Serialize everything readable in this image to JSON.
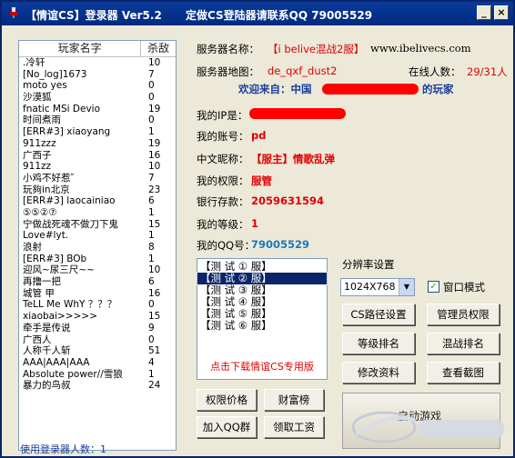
{
  "window": {
    "title": "【情谊CS】登录器 Ver5.2",
    "subtitle": "定做CS登陆器请联系QQ 79005529",
    "min_label": "_",
    "close_label": "×"
  },
  "player_list": {
    "headers": [
      "玩家名字",
      "杀敌"
    ],
    "rows": [
      [
        ".冷轩",
        "10"
      ],
      [
        "[No_log]1673",
        "7"
      ],
      [
        "moto yes",
        "0"
      ],
      [
        "沙漠狐",
        "0"
      ],
      [
        "fnatic MSi Devio",
        "19"
      ],
      [
        "时间煮雨",
        "0"
      ],
      [
        "[ERR#3] xiaoyang",
        "1"
      ],
      [
        "911zzz",
        "19"
      ],
      [
        "广西子",
        "16"
      ],
      [
        "911zz",
        "10"
      ],
      [
        "小鸡不好惹″",
        "7"
      ],
      [
        "玩夠in北京",
        "23"
      ],
      [
        "[ERR#3] laocainiao",
        "6"
      ],
      [
        "⑤⑤②⑦",
        "1"
      ],
      [
        "宁做战死魂不做刀下鬼",
        "15"
      ],
      [
        "Love#lyt.",
        "1"
      ],
      [
        "浪射",
        "8"
      ],
      [
        "[ERR#3] BOb",
        "1"
      ],
      [
        "迎风~尿三尺~~",
        "10"
      ],
      [
        "再撸一把",
        "6"
      ],
      [
        "城管 甲",
        "16"
      ],
      [
        "TeLL Me WhY ？？？",
        "0"
      ],
      [
        "xiaobai>>>>>",
        "15"
      ],
      [
        "牵手是传说",
        "9"
      ],
      [
        "广西人",
        "0"
      ],
      [
        "人称千人斩",
        "51"
      ],
      [
        "AAA|AAA|AAA",
        "4"
      ],
      [
        "Absolute power//雪狼",
        "1"
      ],
      [
        "暴力的鸟叔",
        "24"
      ]
    ],
    "footer": "使用登录器人数：1"
  },
  "info": {
    "server_name_label": "服务器名称：",
    "server_name_value": "【i belive混战2服】",
    "server_url": "www.ibelivecs.com",
    "map_label": "服务器地图：",
    "map_value": "de_qxf_dust2",
    "online_label": "在线人数：",
    "online_value": "29/31人",
    "welcome_prefix": "欢迎来自：中国",
    "welcome_suffix": "的玩家",
    "ip_label": "我的IP是：",
    "account_label": "我的账号：",
    "account_value": "pd",
    "nick_label": "中文昵称：",
    "nick_value": "【服主】情歌乱弹",
    "perm_label": "我的权限：",
    "perm_value": "服管",
    "bank_label": "银行存款：",
    "bank_value": "2059631594",
    "level_label": "我的等级：",
    "level_value": "1",
    "qq_label": "我的QQ号：",
    "qq_value": "79005529"
  },
  "server_list": {
    "items": [
      "【测 试 ① 服】",
      "【测 试 ② 服】",
      "【测 试 ③ 服】",
      "【测 试 ④ 服】",
      "【测 试 ⑤ 服】",
      "【测 试 ⑥ 服】"
    ],
    "selected_index": 1,
    "download_text": "点击下载情谊CS专用版"
  },
  "resolution": {
    "label": "分辨率设置",
    "value": "1024X768",
    "window_mode_label": "窗口模式",
    "window_mode_checked": true
  },
  "buttons": {
    "cs_path": "CS路径设置",
    "admin_perm": "管理员权限",
    "level_rank": "等级排名",
    "melee_rank": "混战排名",
    "edit_profile": "修改资料",
    "view_screenshot": "查看截图",
    "perm_price": "权限价格",
    "wealth_rank": "财富榜",
    "join_qq_group": "加入QQ群",
    "get_salary": "领取工资",
    "launch_game": "启动游戏"
  },
  "colors": {
    "title_bar": "#0a246a",
    "accent_red": "#e00000",
    "accent_blue": "#1a3ca0"
  }
}
